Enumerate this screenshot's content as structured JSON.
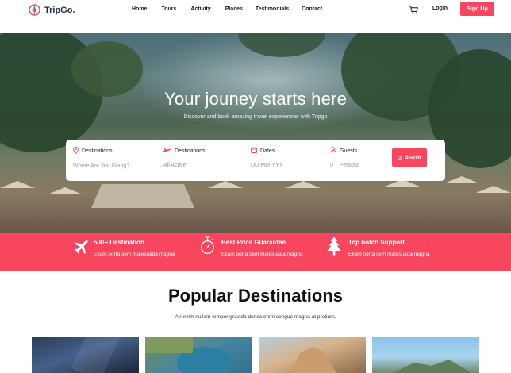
{
  "brand": {
    "name": "TripGo.",
    "colors": {
      "accent": "#f8465e",
      "dark": "#1f2a44"
    }
  },
  "nav": {
    "items": [
      "Home",
      "Tours",
      "Activity",
      "Places",
      "Testimonials",
      "Contact"
    ],
    "cart_icon": "cart-icon",
    "login": "Login",
    "signup": "Sign Up"
  },
  "hero": {
    "title": "Your jouney starts here",
    "subtitle": "Discover and book amazing travel experiences with Tripgo"
  },
  "search": {
    "fields": [
      {
        "label": "Destinations",
        "value": "Where Are You Going?",
        "icon": "location-pin-icon"
      },
      {
        "label": "Destinations",
        "value": "All Active",
        "icon": "plane-icon"
      },
      {
        "label": "Dates",
        "value": "DD-MM-YYY",
        "icon": "calendar-icon"
      },
      {
        "label": "Guests",
        "value": "0    Persons",
        "icon": "user-icon"
      }
    ],
    "button": "Search"
  },
  "features": [
    {
      "title": "500+ Destination",
      "desc": "Etiam porta sem malesuada magna",
      "icon": "airplane-icon"
    },
    {
      "title": "Best Price Guarantee",
      "desc": "Etiam porta sem malesuada magna",
      "icon": "price-tag-icon"
    },
    {
      "title": "Top notch Support",
      "desc": "Etiam porta sem malesuada magna",
      "icon": "tree-icon"
    }
  ],
  "popular": {
    "title": "Popular Destinations",
    "subtitle": "An enim nullam tempor gravida donec enim congue magna at pretium."
  }
}
